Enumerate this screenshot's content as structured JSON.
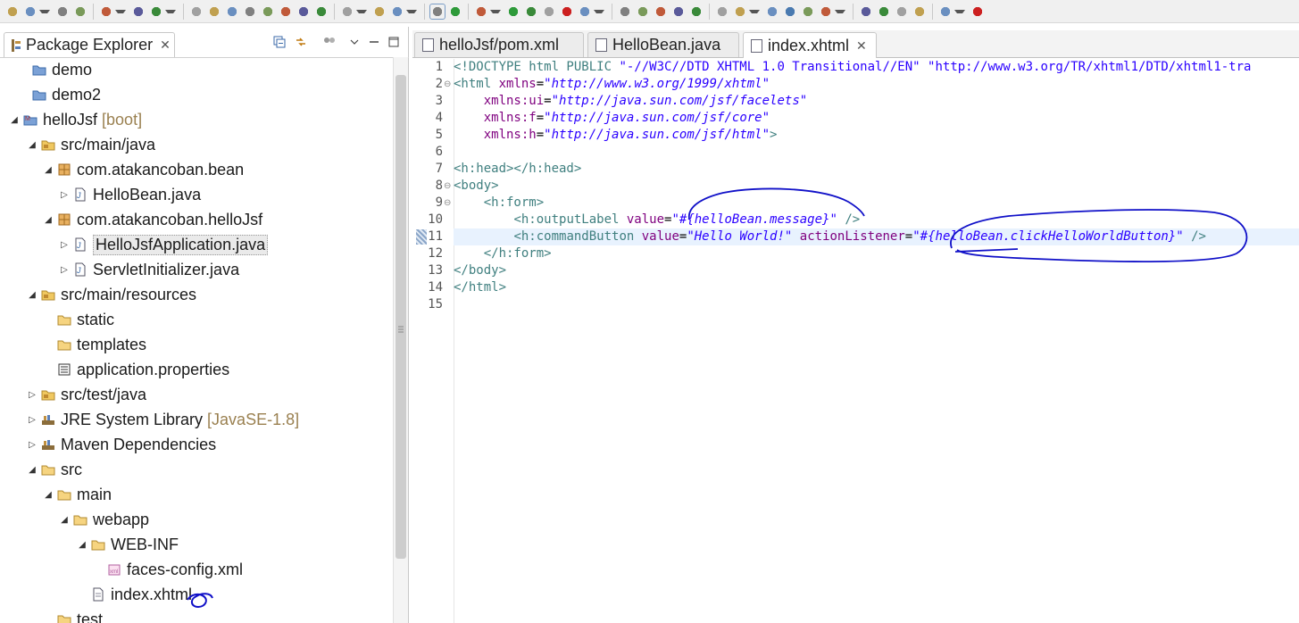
{
  "toolbar": {
    "icons": [
      "new-icon",
      "new-dropdown-icon",
      "save-icon",
      "save-all-icon",
      "print-icon",
      "console-icon",
      "pin-icon",
      "resume-icon",
      "suspend-icon",
      "terminate-icon",
      "disconnect-icon",
      "step-into-icon",
      "step-over-icon",
      "step-return-icon",
      "drop-to-frame-icon",
      "use-step-filters-icon",
      "external-tools-icon",
      "spring-boot-icon",
      "toggle-mark-icon",
      "refresh-icon",
      "debug-icon",
      "run-icon",
      "coverage-icon",
      "run-last-icon",
      "stop-icon",
      "build-icon",
      "search-icon",
      "new-class-icon",
      "new-package-icon",
      "open-type-icon",
      "open-folder-icon",
      "rocket-icon",
      "folder-icon",
      "folder-open-icon",
      "globe-icon",
      "annotation-icon",
      "pin2-icon",
      "next-annotation-icon",
      "prev-annotation-icon",
      "last-edit-icon",
      "back-icon",
      "forward-icon",
      "redhat-icon"
    ]
  },
  "explorer": {
    "title": "Package Explorer",
    "close": "✕",
    "tree": [
      {
        "label": "demo",
        "decor": "",
        "icon": "project-icon",
        "twisty": ""
      },
      {
        "label": "demo2",
        "decor": "",
        "icon": "project-icon",
        "twisty": ""
      },
      {
        "label": "helloJsf",
        "decor": "[boot]",
        "icon": "maven-project-icon",
        "twisty": "◢"
      },
      {
        "label": "src/main/java",
        "decor": "",
        "icon": "source-folder-icon",
        "twisty": "◢"
      },
      {
        "label": "com.atakancoban.bean",
        "decor": "",
        "icon": "package-icon",
        "twisty": "◢"
      },
      {
        "label": "HelloBean.java",
        "decor": "",
        "icon": "java-file-icon",
        "twisty": "▷"
      },
      {
        "label": "com.atakancoban.helloJsf",
        "decor": "",
        "icon": "package-icon",
        "twisty": "◢"
      },
      {
        "label": "HelloJsfApplication.java",
        "decor": "",
        "icon": "java-file-icon",
        "twisty": "▷"
      },
      {
        "label": "ServletInitializer.java",
        "decor": "",
        "icon": "java-file-icon",
        "twisty": "▷"
      },
      {
        "label": "src/main/resources",
        "decor": "",
        "icon": "source-folder-icon",
        "twisty": "◢"
      },
      {
        "label": "static",
        "decor": "",
        "icon": "folder-icon",
        "twisty": ""
      },
      {
        "label": "templates",
        "decor": "",
        "icon": "folder-icon",
        "twisty": ""
      },
      {
        "label": "application.properties",
        "decor": "",
        "icon": "properties-file-icon",
        "twisty": ""
      },
      {
        "label": "src/test/java",
        "decor": "",
        "icon": "source-folder-icon",
        "twisty": "▷"
      },
      {
        "label": "JRE System Library",
        "decor": "[JavaSE-1.8]",
        "icon": "library-icon",
        "twisty": "▷"
      },
      {
        "label": "Maven Dependencies",
        "decor": "",
        "icon": "library-icon",
        "twisty": "▷"
      },
      {
        "label": "src",
        "decor": "",
        "icon": "folder-icon",
        "twisty": "◢"
      },
      {
        "label": "main",
        "decor": "",
        "icon": "folder-icon",
        "twisty": "◢"
      },
      {
        "label": "webapp",
        "decor": "",
        "icon": "folder-icon",
        "twisty": "◢"
      },
      {
        "label": "WEB-INF",
        "decor": "",
        "icon": "folder-icon",
        "twisty": "◢"
      },
      {
        "label": "faces-config.xml",
        "decor": "",
        "icon": "xml-file-icon",
        "twisty": ""
      },
      {
        "label": "index.xhtml",
        "decor": "",
        "icon": "xhtml-file-icon",
        "twisty": ""
      },
      {
        "label": "test",
        "decor": "",
        "icon": "folder-icon",
        "twisty": ""
      }
    ]
  },
  "editor": {
    "tabs": [
      {
        "label": "helloJsf/pom.xml",
        "active": false
      },
      {
        "label": "HelloBean.java",
        "active": false
      },
      {
        "label": "index.xhtml",
        "active": true
      }
    ],
    "close": "✕",
    "current_line": 11,
    "lines": [
      {
        "num": "1",
        "fold": "",
        "tokens": [
          [
            "dt",
            "<!DOCTYPE html PUBLIC "
          ],
          [
            "v2",
            "\"-//W3C//DTD XHTML 1.0 Transitional//EN\""
          ],
          [
            "p",
            " "
          ],
          [
            "v2",
            "\"http://www.w3.org/TR/xhtml1/DTD/xhtml1-tra"
          ]
        ]
      },
      {
        "num": "2",
        "fold": "⊖",
        "tokens": [
          [
            "t",
            "<html "
          ],
          [
            "a",
            "xmlns"
          ],
          [
            "p",
            "="
          ],
          [
            "v",
            "\"http://www.w3.org/1999/xhtml\""
          ]
        ]
      },
      {
        "num": "3",
        "fold": "",
        "tokens": [
          [
            "p",
            "    "
          ],
          [
            "a",
            "xmlns:ui"
          ],
          [
            "p",
            "="
          ],
          [
            "v",
            "\"http://java.sun.com/jsf/facelets\""
          ]
        ]
      },
      {
        "num": "4",
        "fold": "",
        "tokens": [
          [
            "p",
            "    "
          ],
          [
            "a",
            "xmlns:f"
          ],
          [
            "p",
            "="
          ],
          [
            "v",
            "\"http://java.sun.com/jsf/core\""
          ]
        ]
      },
      {
        "num": "5",
        "fold": "",
        "tokens": [
          [
            "p",
            "    "
          ],
          [
            "a",
            "xmlns:h"
          ],
          [
            "p",
            "="
          ],
          [
            "v",
            "\"http://java.sun.com/jsf/html\""
          ],
          [
            "t",
            ">"
          ]
        ]
      },
      {
        "num": "6",
        "fold": "",
        "tokens": []
      },
      {
        "num": "7",
        "fold": "",
        "tokens": [
          [
            "t",
            "<h:head></h:head>"
          ]
        ]
      },
      {
        "num": "8",
        "fold": "⊖",
        "tokens": [
          [
            "t",
            "<body>"
          ]
        ]
      },
      {
        "num": "9",
        "fold": "⊖",
        "tokens": [
          [
            "p",
            "    "
          ],
          [
            "t",
            "<h:form>"
          ]
        ]
      },
      {
        "num": "10",
        "fold": "",
        "tokens": [
          [
            "p",
            "        "
          ],
          [
            "t",
            "<h:outputLabel "
          ],
          [
            "a",
            "value"
          ],
          [
            "p",
            "="
          ],
          [
            "v",
            "\"#{helloBean.message}\""
          ],
          [
            "p",
            " "
          ],
          [
            "t",
            "/>"
          ]
        ]
      },
      {
        "num": "11",
        "fold": "",
        "tokens": [
          [
            "p",
            "        "
          ],
          [
            "t",
            "<h:commandButton "
          ],
          [
            "a",
            "value"
          ],
          [
            "p",
            "="
          ],
          [
            "v",
            "\"Hello World!\""
          ],
          [
            "p",
            " "
          ],
          [
            "a",
            "actionListener"
          ],
          [
            "p",
            "="
          ],
          [
            "v",
            "\"#{helloBean.clickHelloWorldButton}\""
          ],
          [
            "p",
            " "
          ],
          [
            "t",
            "/>"
          ]
        ]
      },
      {
        "num": "12",
        "fold": "",
        "tokens": [
          [
            "p",
            "    "
          ],
          [
            "t",
            "</h:form>"
          ]
        ]
      },
      {
        "num": "13",
        "fold": "",
        "tokens": [
          [
            "t",
            "</body>"
          ]
        ]
      },
      {
        "num": "14",
        "fold": "",
        "tokens": [
          [
            "t",
            "</html>"
          ]
        ]
      },
      {
        "num": "15",
        "fold": "",
        "tokens": []
      }
    ]
  },
  "colors": {
    "tag": "#3f7f7f",
    "attribute": "#7f007f",
    "string": "#2a00ff",
    "current_line": "#e8f2fe",
    "annotation_ink": "#1010c8",
    "decoration": "#9a8050"
  }
}
